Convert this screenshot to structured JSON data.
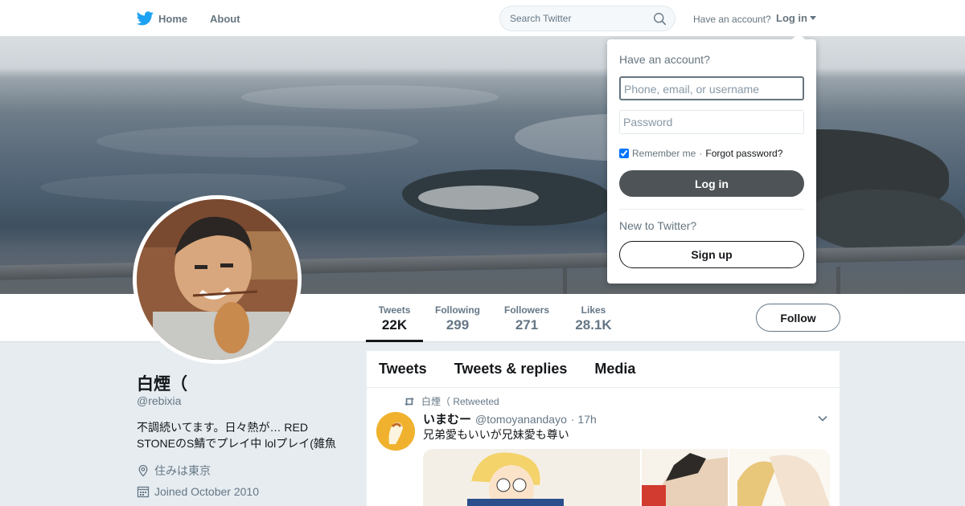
{
  "nav": {
    "home": "Home",
    "about": "About"
  },
  "search": {
    "placeholder": "Search Twitter"
  },
  "account": {
    "prompt": "Have an account?",
    "login": "Log in"
  },
  "profile": {
    "name": "白煙（",
    "handle": "@rebixia",
    "bio": "不調続いてます。日々熱が… RED STONEのS鯖でプレイ中 lolプレイ(雑魚",
    "location": "住みは東京",
    "joined": "Joined October 2010"
  },
  "stats": [
    {
      "label": "Tweets",
      "value": "22K"
    },
    {
      "label": "Following",
      "value": "299"
    },
    {
      "label": "Followers",
      "value": "271"
    },
    {
      "label": "Likes",
      "value": "28.1K"
    }
  ],
  "follow_label": "Follow",
  "tabs": [
    "Tweets",
    "Tweets & replies",
    "Media"
  ],
  "tweet": {
    "retweeted_by": "白煙（ Retweeted",
    "author_name": "いまむー",
    "author_handle": "@tomoyanandayo",
    "time": "· 17h",
    "text": "兄弟愛もいいが兄妹愛も尊い"
  },
  "login_dropdown": {
    "title": "Have an account?",
    "username_placeholder": "Phone, email, or username",
    "password_placeholder": "Password",
    "remember": "Remember me",
    "separator": "·",
    "forgot": "Forgot password?",
    "login_button": "Log in",
    "new_prompt": "New to Twitter?",
    "signup_button": "Sign up"
  },
  "colors": {
    "accent": "#1da1f2",
    "text": "#14171a",
    "muted": "#657786",
    "background": "#e6ecf0"
  }
}
